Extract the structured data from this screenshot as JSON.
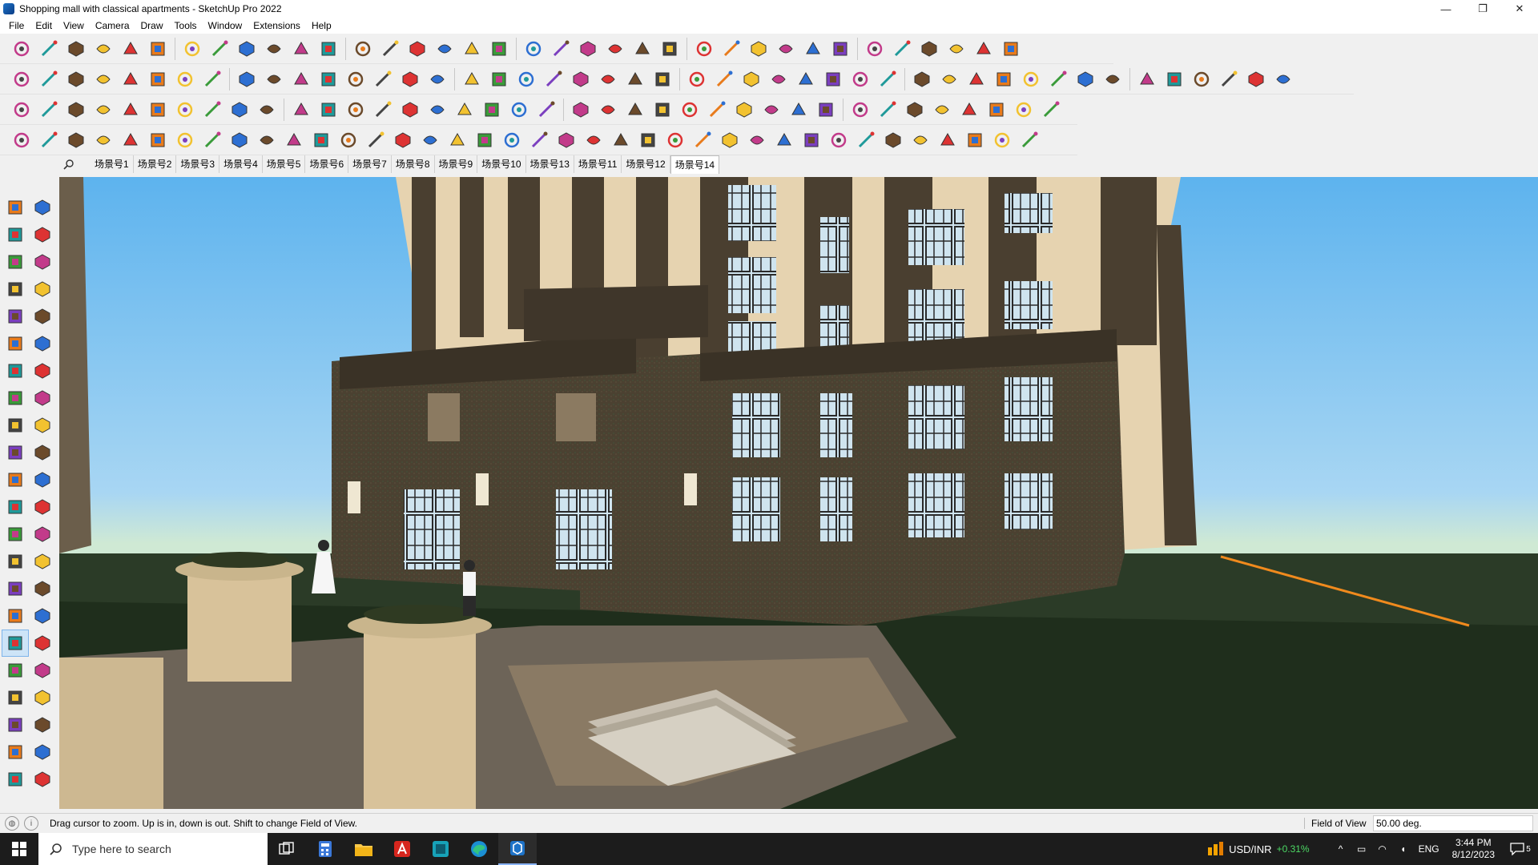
{
  "window": {
    "title": "Shopping mall with classical apartments - SketchUp Pro 2022",
    "controls": [
      "—",
      "❐",
      "✕"
    ]
  },
  "menu": [
    "File",
    "Edit",
    "View",
    "Camera",
    "Draw",
    "Tools",
    "Window",
    "Extensions",
    "Help"
  ],
  "scenes": {
    "tabs": [
      "场景号1",
      "场景号2",
      "场景号3",
      "场景号4",
      "场景号5",
      "场景号6",
      "场景号7",
      "场景号8",
      "场景号9",
      "场景号10",
      "场景号13",
      "场景号11",
      "场景号12",
      "场景号14"
    ],
    "active_index": 13
  },
  "status": {
    "message": "Drag cursor to zoom.  Up is in, down is out. Shift to change Field of View.",
    "vcb_label": "Field of View",
    "vcb_value": "50.00 deg."
  },
  "taskbar": {
    "search_placeholder": "Type here to search",
    "ticker_symbol": "USD/INR",
    "ticker_change": "+0.31%",
    "language": "ENG",
    "time": "3:44 PM",
    "date": "8/12/2023",
    "notifications": "5"
  },
  "colors": {
    "sky": "#66b8f0",
    "facade_dark": "#4a3f30",
    "facade_cream": "#e6d3b0",
    "grass": "#1f2e1c",
    "axis_red_orange": "#f08a1d"
  }
}
